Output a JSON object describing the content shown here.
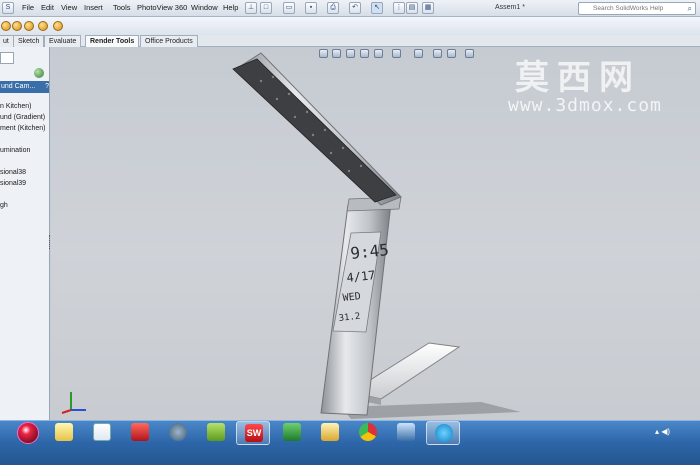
{
  "menubar": {
    "items": [
      "File",
      "Edit",
      "View",
      "Insert",
      "Tools",
      "PhotoView 360",
      "Window",
      "Help"
    ],
    "doc_title": "Assem1 *",
    "search_placeholder": "Search SolidWorks Help"
  },
  "tabs": [
    {
      "label": "ut",
      "active": false
    },
    {
      "label": "Sketch",
      "active": false
    },
    {
      "label": "Evaluate",
      "active": false
    },
    {
      "label": "Render Tools",
      "active": true
    },
    {
      "label": "Office Products",
      "active": false
    }
  ],
  "left_panel": {
    "header": "und Cam...",
    "help_label": "?",
    "items": [
      "n Kitchen)",
      "und (Gradient)",
      "ment (Kitchen)",
      "umination",
      "sional38",
      "sional39",
      "gh"
    ]
  },
  "watermark": {
    "chinese": "莫西网",
    "url": "www.3dmox.com"
  },
  "lamp_display": {
    "time": "9:45",
    "date": "4/17",
    "weekday": "WED",
    "temp": "31.2"
  },
  "taskbar": {
    "apps": [
      "calendar-badge-app",
      "folder-notes-app",
      "gmail-app",
      "red-photo-app",
      "mouse-app",
      "notebook-app",
      "solidworks-app",
      "sheet-app",
      "explorer-app",
      "chrome-app",
      "network-app",
      "skype-app"
    ],
    "active_app_index": 6
  },
  "colors": {
    "accent": "#3a6ea8",
    "taskbar": "#2d66a8",
    "viewport_bg": "#cbd0d6",
    "solidworks_red": "#d2202b"
  }
}
